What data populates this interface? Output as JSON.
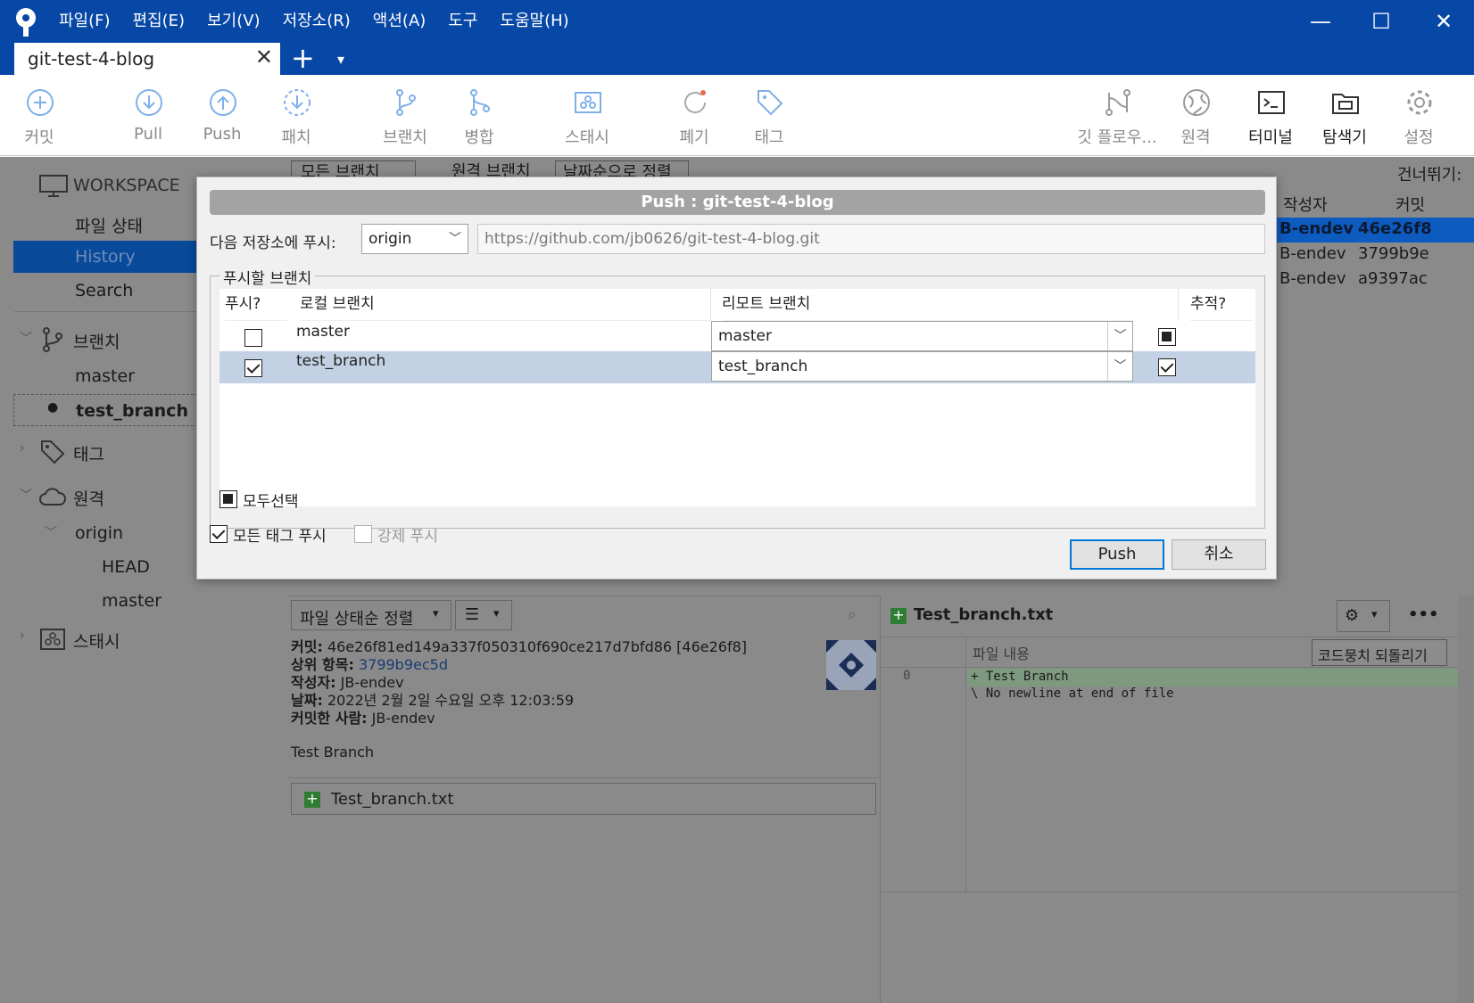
{
  "menu": [
    "파일(F)",
    "편집(E)",
    "보기(V)",
    "저장소(R)",
    "액션(A)",
    "도구",
    "도움말(H)"
  ],
  "window_controls": {
    "minimize": "—",
    "maximize": "☐",
    "close": "✕"
  },
  "tab": {
    "title": "git-test-4-blog",
    "close": "✕",
    "add": "+",
    "dropdown": "▾"
  },
  "toolbar": {
    "commit": "커밋",
    "pull": "Pull",
    "push": "Push",
    "fetch": "패치",
    "branch": "브랜치",
    "merge": "병합",
    "stash": "스태시",
    "discard": "폐기",
    "tag": "태그",
    "git_flow": "깃 플로우...",
    "remote": "원격",
    "terminal": "터미널",
    "explorer": "탐색기",
    "settings": "설정"
  },
  "sidebar": {
    "workspace": "WORKSPACE",
    "file_status": "파일 상태",
    "history": "History",
    "search": "Search",
    "branches": "브랜치",
    "branch_master": "master",
    "branch_current": "test_branch",
    "tags": "태그",
    "remotes": "원격",
    "origin": "origin",
    "origin_head": "HEAD",
    "origin_master": "master",
    "stashes": "스태시"
  },
  "history_panel": {
    "filter_all": "모든 브랜치",
    "remote_branches": "원격 브랜치",
    "sort": "날짜순으로 정렬",
    "skip": "건너뛰기:",
    "col_author": "작성자",
    "col_commit": "커밋",
    "rows": [
      {
        "author": "B-endev",
        "commit": "46e26f8"
      },
      {
        "author": "B-endev",
        "commit": "3799b9e"
      },
      {
        "author": "B-endev",
        "commit": "a9397ac"
      }
    ]
  },
  "details": {
    "sort_label": "파일 상태순 정렬",
    "commit_label": "커밋:",
    "commit_value": "46e26f81ed149a337f050310f690ce217d7bfd86 [46e26f8]",
    "parent_label": "상위 항목:",
    "parent_value": "3799b9ec5d",
    "author_label": "작성자:",
    "author_value": "JB-endev",
    "date_label": "날짜:",
    "date_value": "2022년 2월 2일 수요일 오후 12:03:59",
    "committer_label": "커밋한 사람:",
    "committer_value": "JB-endev",
    "message": "Test Branch",
    "file": "Test_branch.txt"
  },
  "diff": {
    "file": "Test_branch.txt",
    "content_label": "파일 내용",
    "revert_button": "코드뭉치 되돌리기",
    "line_no": "0",
    "line1": "+ Test Branch",
    "line2": "\\  No newline at end of file",
    "more": "•••"
  },
  "dialog": {
    "title": "Push :  git-test-4-blog",
    "push_to_label": "다음 저장소에 푸시:",
    "remote_select": "origin",
    "remote_url": "https://github.com/jb0626/git-test-4-blog.git",
    "group_label": "푸시할 브랜치",
    "col_push": "푸시?",
    "col_local": "로컬 브랜치",
    "col_remote": "리모트 브랜치",
    "col_track": "추적?",
    "branches": [
      {
        "local": "master",
        "remote": "master",
        "push": false,
        "track": "partial"
      },
      {
        "local": "test_branch",
        "remote": "test_branch",
        "push": true,
        "track": "checked"
      }
    ],
    "select_all": "모두선택",
    "push_all_tags": "모든 태그 푸시",
    "force_push": "강제 푸시",
    "push_button": "Push",
    "cancel_button": "취소"
  },
  "colors": {
    "titlebar": "#0747a6",
    "selection": "#0e5bbf",
    "selected_row": "#c2d2e4",
    "primary_border": "#0078d7"
  }
}
